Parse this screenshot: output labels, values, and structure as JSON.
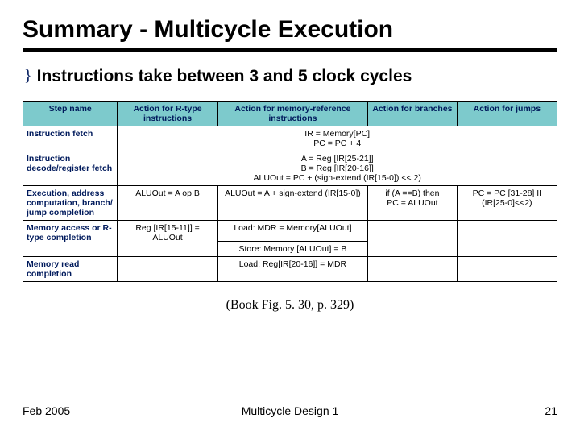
{
  "title": "Summary - Multicycle Execution",
  "bullet_glyph": "}",
  "bullet": "Instructions take between 3 and 5 clock cycles",
  "headers": {
    "step": "Step name",
    "rtype": "Action for R-type instructions",
    "mem": "Action for memory-reference instructions",
    "branch": "Action for branches",
    "jump": "Action for jumps"
  },
  "rows": [
    {
      "name": "Instruction fetch",
      "full": {
        "l1": "IR = Memory[PC]",
        "l2": "PC = PC + 4"
      }
    },
    {
      "name": "Instruction decode/register fetch",
      "full": {
        "l1": "A = Reg [IR[25-21]]",
        "l2": "B = Reg [IR[20-16]]",
        "l3": "ALUOut = PC + (sign-extend (IR[15-0]) << 2)"
      }
    },
    {
      "name": "Execution, address computation, branch/ jump completion",
      "r": "ALUOut = A op B",
      "m": "ALUOut = A + sign-extend (IR[15-0])",
      "b": {
        "l1": "if (A ==B) then",
        "l2": "PC = ALUOut"
      },
      "j": {
        "l1": "PC = PC [31-28] II",
        "l2": "(IR[25-0]<<2)"
      }
    },
    {
      "name": "Memory access or R-type completion",
      "r": {
        "l1": "Reg [IR[15-11]] =",
        "l2": "ALUOut"
      },
      "m": {
        "l1": "Load: MDR = Memory[ALUOut]",
        "l2": "Store: Memory [ALUOut] = B"
      },
      "b": "",
      "j": ""
    },
    {
      "name": "Memory read completion",
      "r": "",
      "m": "Load: Reg[IR[20-16]] = MDR",
      "b": "",
      "j": ""
    }
  ],
  "caption": "(Book Fig. 5. 30, p. 329)",
  "footer": {
    "left": "Feb 2005",
    "center": "Multicycle Design 1",
    "right": "21"
  }
}
